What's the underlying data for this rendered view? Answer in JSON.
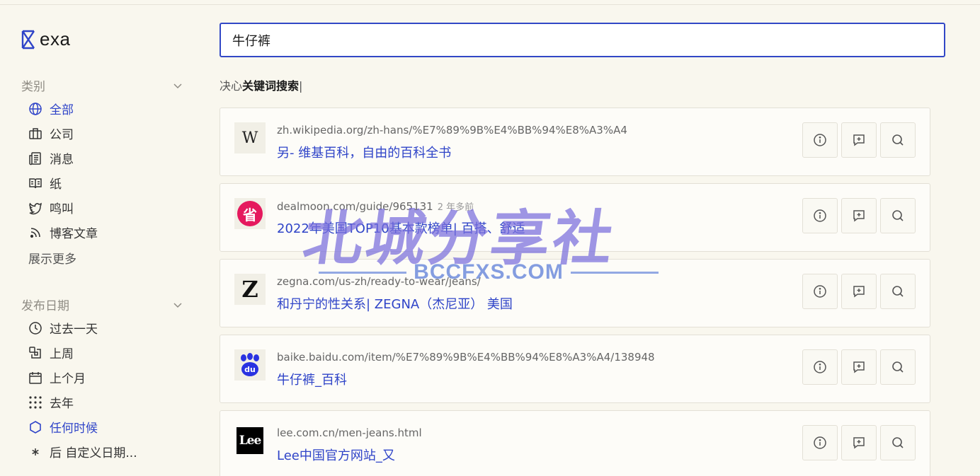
{
  "brand": {
    "name": "exa"
  },
  "search": {
    "query": "牛仔裤"
  },
  "mode": {
    "prefix": "决心",
    "label": "关键词搜索",
    "cursor": "|"
  },
  "sidebar": {
    "category": {
      "title": "类别",
      "items": [
        {
          "label": "全部",
          "icon": "globe-icon",
          "active": true
        },
        {
          "label": "公司",
          "icon": "briefcase-icon",
          "active": false
        },
        {
          "label": "消息",
          "icon": "news-icon",
          "active": false
        },
        {
          "label": "纸",
          "icon": "book-icon",
          "active": false
        },
        {
          "label": "鸣叫",
          "icon": "twitter-icon",
          "active": false
        },
        {
          "label": "博客文章",
          "icon": "rss-icon",
          "active": false
        }
      ],
      "show_more": "展示更多"
    },
    "date": {
      "title": "发布日期",
      "items": [
        {
          "label": "过去一天",
          "icon": "clock-icon",
          "active": false
        },
        {
          "label": "上周",
          "icon": "week-icon",
          "active": false
        },
        {
          "label": "上个月",
          "icon": "calendar-icon",
          "active": false
        },
        {
          "label": "去年",
          "icon": "dots-grid-icon",
          "active": false
        },
        {
          "label": "任何时候",
          "icon": "hexagon-icon",
          "active": true
        },
        {
          "label": "后 自定义日期...",
          "icon": "asterisk-icon",
          "active": false
        }
      ]
    }
  },
  "results": [
    {
      "favicon": "wikipedia-logo",
      "favicon_text": "W",
      "url": "zh.wikipedia.org/zh-hans/%E7%89%9B%E4%BB%94%E8%A3%A4",
      "age": "",
      "title": "另- 维基百科，自由的百科全书"
    },
    {
      "favicon": "dealmoon-logo",
      "favicon_text": "省",
      "url": "dealmoon.com/guide/965131",
      "age": "2 年多前",
      "title": "2022年美国TOP10基本款榜单| 百搭、舒适"
    },
    {
      "favicon": "zegna-logo",
      "favicon_text": "Z",
      "url": "zegna.com/us-zh/ready-to-wear/jeans/",
      "age": "",
      "title": "和丹宁的性关系| ZEGNA（杰尼亚） 美国"
    },
    {
      "favicon": "baidu-logo",
      "favicon_text": "du",
      "url": "baike.baidu.com/item/%E7%89%9B%E4%BB%94%E8%A3%A4/138948",
      "age": "",
      "title": "牛仔裤_百科"
    },
    {
      "favicon": "lee-logo",
      "favicon_text": "Lee",
      "url": "lee.com.cn/men-jeans.html",
      "age": "",
      "title": "Lee中国官方网站_又"
    }
  ],
  "watermark": {
    "title": "北城分享社",
    "subtitle": "BCCFXS.COM"
  },
  "colors": {
    "accent": "#2f44c8",
    "background": "#f9f7ee",
    "dealmoon": "#e5195e",
    "baidu": "#2932e1"
  }
}
